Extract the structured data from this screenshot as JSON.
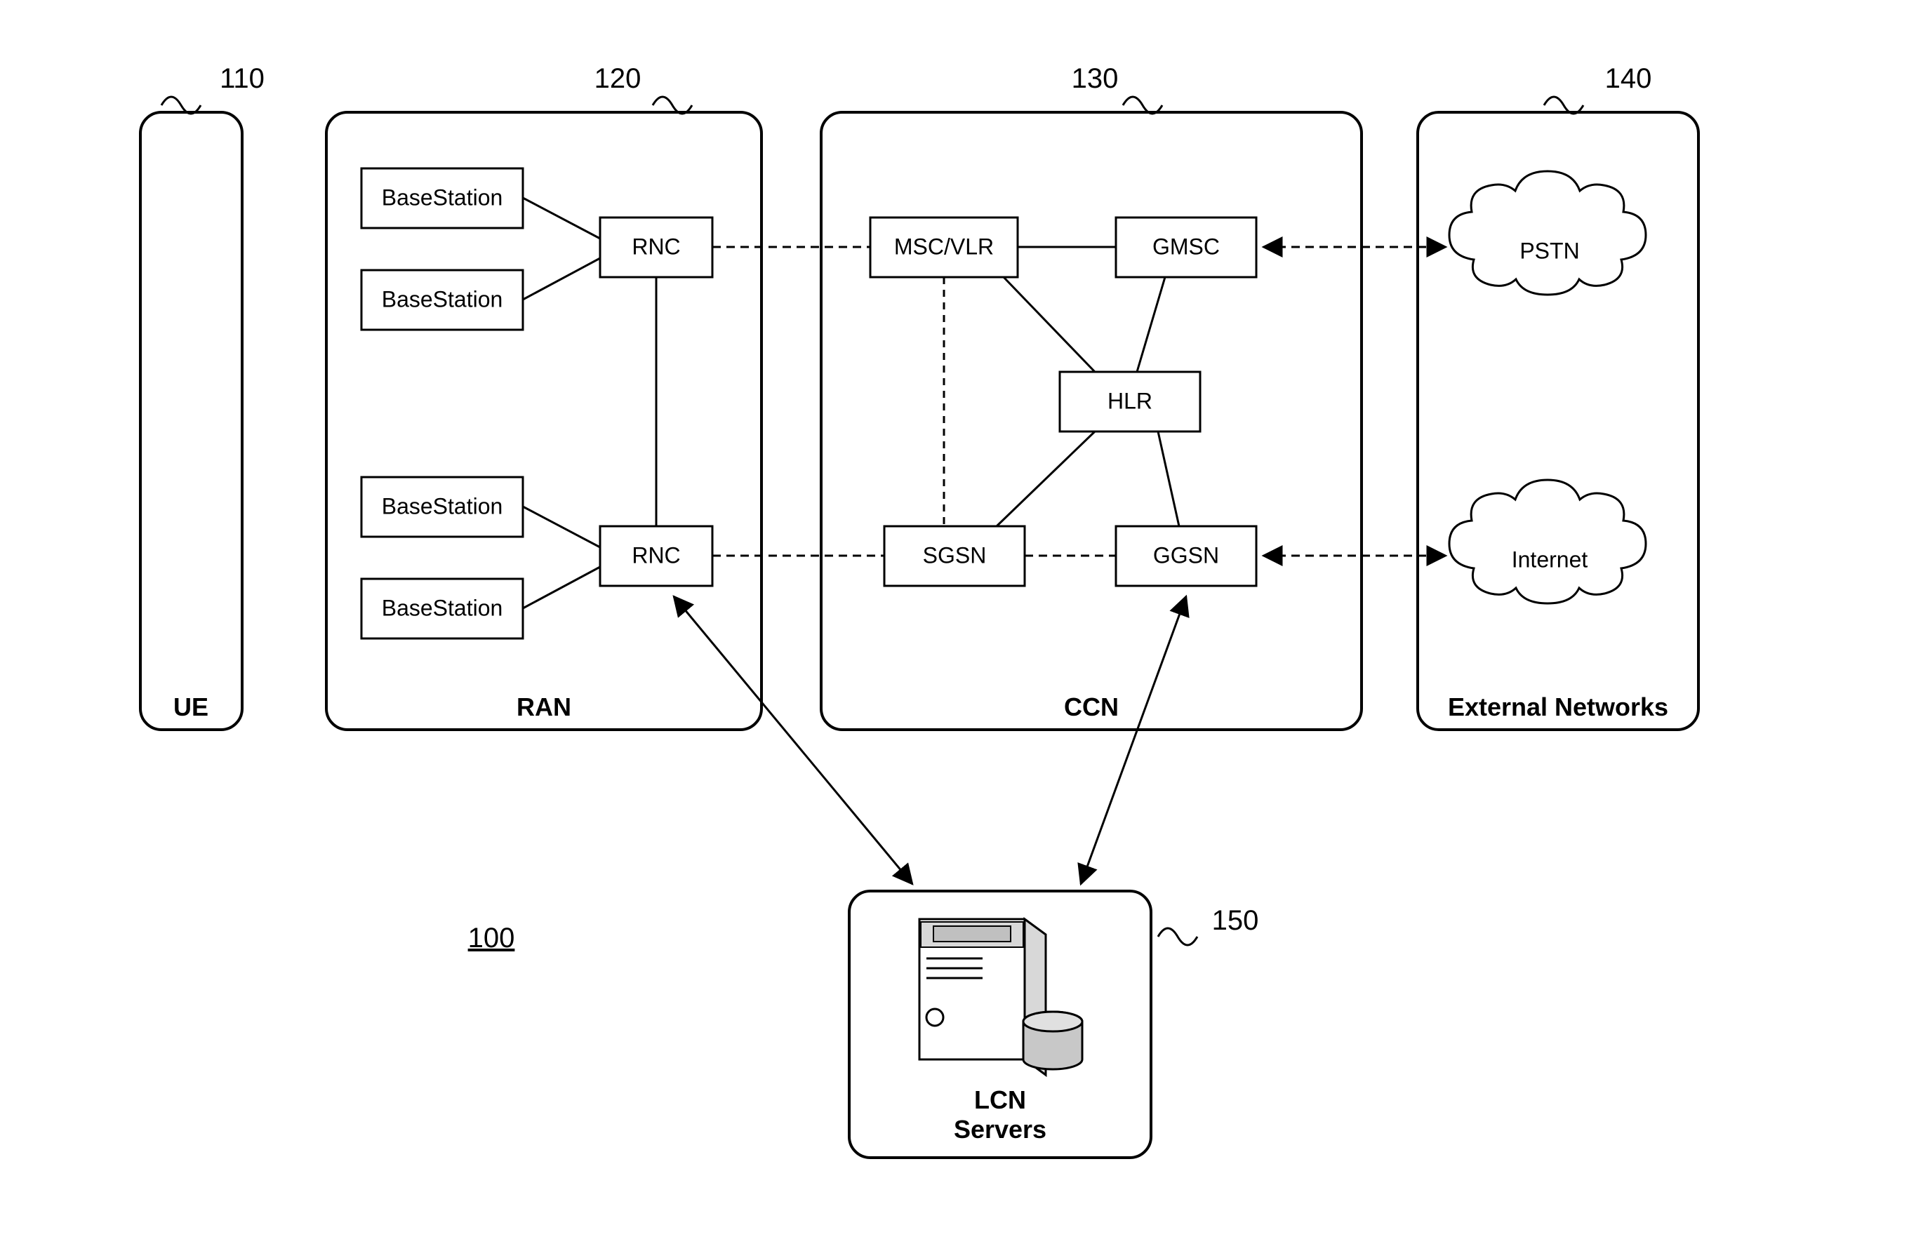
{
  "figure_id": "100",
  "callouts": {
    "ue": "110",
    "ran": "120",
    "ccn": "130",
    "ext": "140",
    "lcn": "150"
  },
  "panels": {
    "ue": {
      "label": "UE"
    },
    "ran": {
      "label": "RAN"
    },
    "ccn": {
      "label": "CCN"
    },
    "ext": {
      "label": "External Networks"
    },
    "lcn_line1": "LCN",
    "lcn_line2": "Servers"
  },
  "nodes": {
    "bs1": "BaseStation",
    "bs2": "BaseStation",
    "bs3": "BaseStation",
    "bs4": "BaseStation",
    "rnc1": "RNC",
    "rnc2": "RNC",
    "mscvlr": "MSC/VLR",
    "gmsc": "GMSC",
    "hlr": "HLR",
    "sgsn": "SGSN",
    "ggsn": "GGSN",
    "pstn": "PSTN",
    "internet": "Internet"
  }
}
